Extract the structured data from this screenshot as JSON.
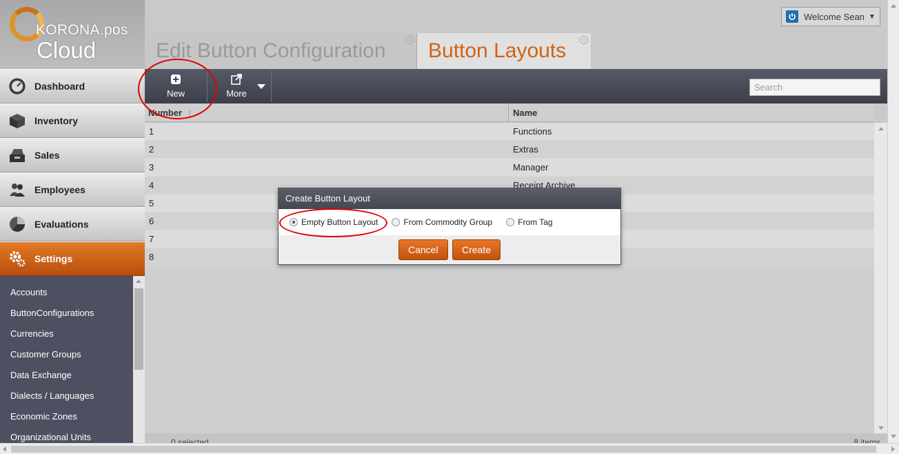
{
  "brand": {
    "line1": "KORONA.pos",
    "line2": "Cloud"
  },
  "header": {
    "welcome": "Welcome Sean"
  },
  "tabs": [
    {
      "label": "Edit Button Configuration",
      "active": false
    },
    {
      "label": "Button Layouts",
      "active": true
    }
  ],
  "nav": {
    "items": [
      {
        "label": "Dashboard",
        "icon": "gauge-icon"
      },
      {
        "label": "Inventory",
        "icon": "box-icon"
      },
      {
        "label": "Sales",
        "icon": "register-icon"
      },
      {
        "label": "Employees",
        "icon": "people-icon"
      },
      {
        "label": "Evaluations",
        "icon": "pie-chart-icon"
      },
      {
        "label": "Settings",
        "icon": "gear-icon",
        "active": true
      }
    ],
    "sub_items": [
      "Accounts",
      "ButtonConfigurations",
      "Currencies",
      "Customer Groups",
      "Data Exchange",
      "Dialects / Languages",
      "Economic Zones",
      "Organizational Units"
    ]
  },
  "toolbar": {
    "new_label": "New",
    "more_label": "More",
    "search_placeholder": "Search"
  },
  "table": {
    "columns": [
      "Number",
      "Name"
    ],
    "sort_indicator": "↑",
    "rows": [
      {
        "number": "1",
        "name": "Functions"
      },
      {
        "number": "2",
        "name": "Extras"
      },
      {
        "number": "3",
        "name": "Manager"
      },
      {
        "number": "4",
        "name": "Receipt Archive"
      },
      {
        "number": "5",
        "name": ""
      },
      {
        "number": "6",
        "name": ""
      },
      {
        "number": "7",
        "name": ""
      },
      {
        "number": "8",
        "name": ""
      }
    ],
    "footer_left": "0 selected",
    "footer_right": "8 items"
  },
  "modal": {
    "title": "Create Button Layout",
    "options": [
      {
        "label": "Empty Button Layout",
        "checked": true
      },
      {
        "label": "From Commodity Group",
        "checked": false
      },
      {
        "label": "From Tag",
        "checked": false
      }
    ],
    "cancel_label": "Cancel",
    "create_label": "Create"
  },
  "colors": {
    "accent": "#d06315",
    "annotation": "#e00000",
    "toolbar": "#484b56"
  }
}
